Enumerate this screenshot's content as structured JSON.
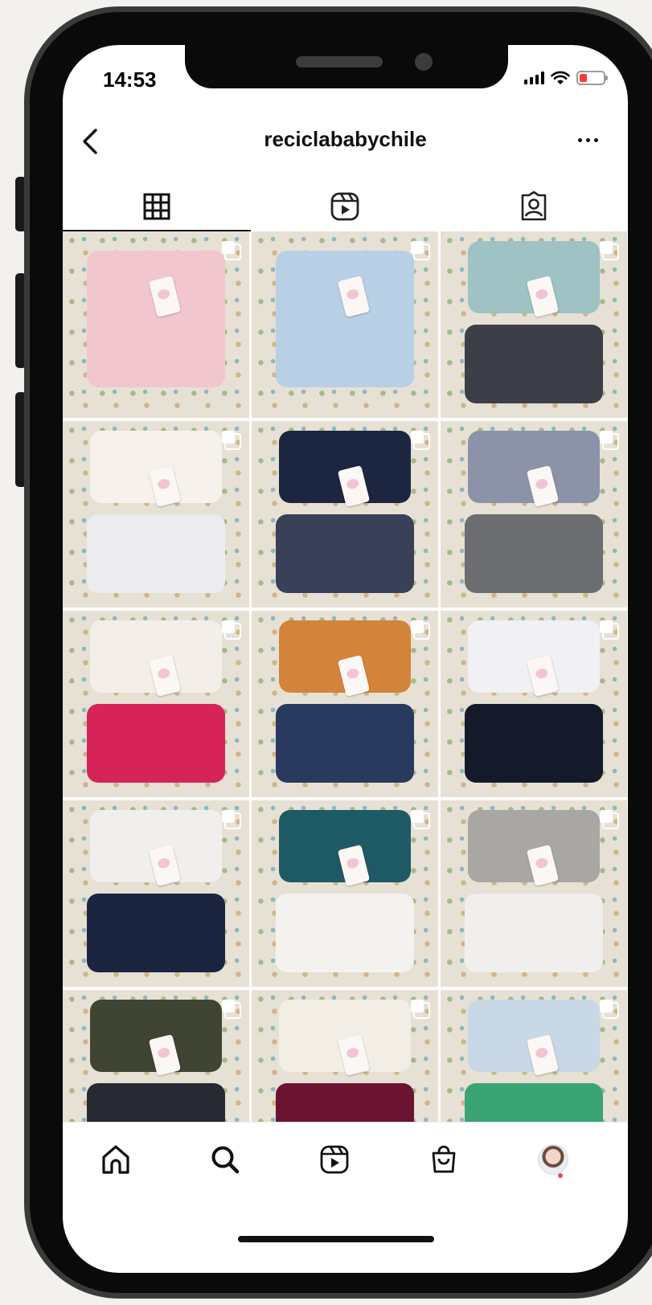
{
  "status_bar": {
    "time": "14:53",
    "battery_color": "#ff3b30"
  },
  "header": {
    "back_icon": "chevron-left-icon",
    "title": "reciclababychile",
    "more_icon": "more-horizontal-icon"
  },
  "profile_tabs": [
    {
      "icon": "grid-icon",
      "active": true
    },
    {
      "icon": "reels-icon",
      "active": false
    },
    {
      "icon": "tagged-icon",
      "active": false
    }
  ],
  "posts": [
    {
      "type": "carousel",
      "colors": [
        "#f2c6cf"
      ]
    },
    {
      "type": "carousel",
      "colors": [
        "#b8d0e6"
      ]
    },
    {
      "type": "carousel",
      "colors": [
        "#9fc3c4",
        "#3d3f48"
      ]
    },
    {
      "type": "carousel",
      "colors": [
        "#f6f1ea",
        "#ecebef"
      ]
    },
    {
      "type": "carousel",
      "colors": [
        "#1d2640",
        "#3a4058"
      ]
    },
    {
      "type": "carousel",
      "colors": [
        "#8c93a8",
        "#6d6e72"
      ]
    },
    {
      "type": "carousel",
      "colors": [
        "#f4eee8",
        "#d72458"
      ]
    },
    {
      "type": "carousel",
      "colors": [
        "#d4843a",
        "#2a3a5e"
      ]
    },
    {
      "type": "carousel",
      "colors": [
        "#f1f0f4",
        "#151a2b"
      ]
    },
    {
      "type": "carousel",
      "colors": [
        "#f1efee",
        "#1c2540"
      ]
    },
    {
      "type": "carousel",
      "colors": [
        "#1e5a66",
        "#f4f2ee"
      ]
    },
    {
      "type": "carousel",
      "colors": [
        "#a9a7a3",
        "#f0efee"
      ]
    },
    {
      "type": "carousel",
      "colors": [
        "#3f4532",
        "#272a33"
      ]
    },
    {
      "type": "carousel",
      "colors": [
        "#f3eee5",
        "#6b1432"
      ]
    },
    {
      "type": "carousel",
      "colors": [
        "#c9d8e6",
        "#3aa474"
      ]
    }
  ],
  "bottom_nav": [
    {
      "icon": "home-icon"
    },
    {
      "icon": "search-icon"
    },
    {
      "icon": "reels-icon"
    },
    {
      "icon": "shop-icon"
    },
    {
      "icon": "profile-avatar",
      "notification_dot_color": "#ed4956"
    }
  ]
}
